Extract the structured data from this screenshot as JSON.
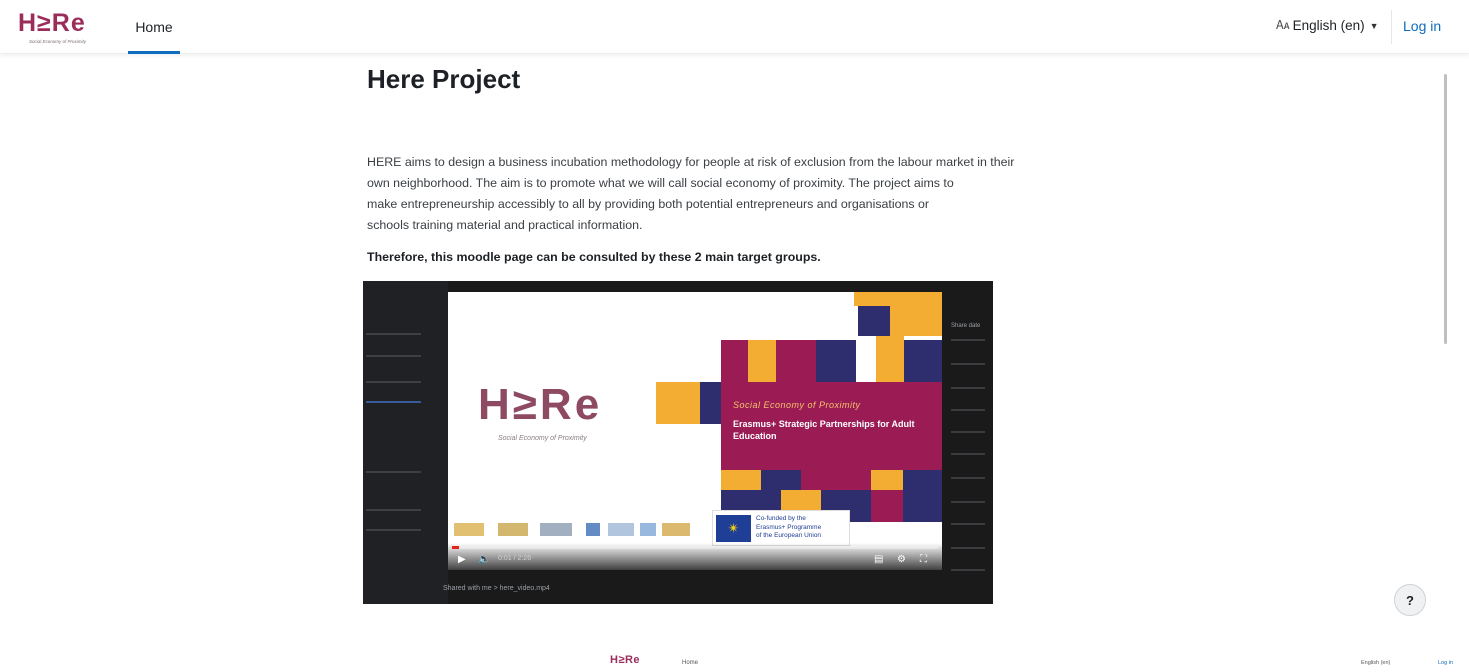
{
  "navbar": {
    "brand_word": "H≥Re",
    "brand_tagline": "Social Economy of Proximity",
    "home_label": "Home",
    "language_label": "English (en)",
    "language_icon": "language-icon",
    "login_label": "Log in"
  },
  "main": {
    "title": "Here Project",
    "intro_lines": [
      "HERE aims to design a business incubation methodology for people at risk of exclusion from the labour market in their",
      "own neighborhood. The aim is to promote what we will call social economy of proximity. The project aims to",
      "make entrepreneurship accessibly to all by providing both potential entrepreneurs and organisations or",
      "schools training material and practical information."
    ],
    "lead": "Therefore, this moodle page can be consulted by these 2 main target groups."
  },
  "video": {
    "slide_logo": "H≥Re",
    "slide_tagline": "Social Economy of Proximity",
    "panel_italic": "Social Economy of Proximity",
    "panel_bold": "Erasmus+ Strategic Partnerships for Adult Education",
    "eu_text": [
      "Co-funded by the",
      "Erasmus+ Programme",
      "of the European Union"
    ],
    "time": "0:01 / 2:26",
    "progress": 0.015,
    "side_header": "Share date",
    "bottom_text": "Shared with me  >  here_video.mp4"
  },
  "help": {
    "label": "?"
  },
  "mini_navbar": {
    "brand_word": "H≥Re",
    "home_label": "Home",
    "language_label": "English (en)",
    "login_label": "Log in"
  },
  "colors": {
    "brand": "#9b2d5b",
    "link": "#0f6cbf",
    "panel_magenta": "#9b1c55",
    "panel_yellow": "#f2ad32",
    "panel_navy": "#2e2d6e"
  }
}
